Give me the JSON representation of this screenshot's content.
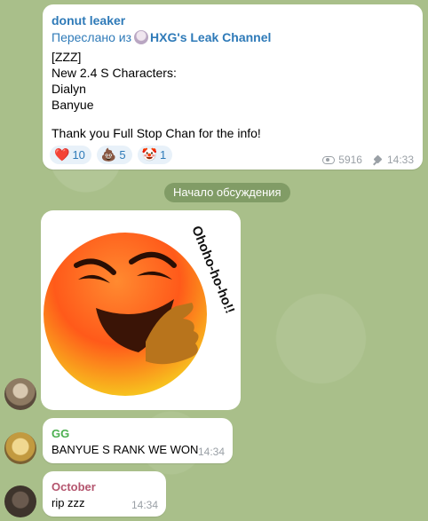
{
  "colors": {
    "accent": "#2e7ab8",
    "sender_top": "#2e7ab8",
    "sender_gg": "#4caf50",
    "sender_october": "#b4556e",
    "divider_bg": "#6f8a58",
    "reaction_bg": "#e8f1f9"
  },
  "top_message": {
    "sender": "donut leaker",
    "forwarded_prefix": "Переслано из",
    "channel": "HXG's Leak Channel",
    "lines": [
      "[ZZZ]",
      "New 2.4 S Characters:",
      "Dialyn",
      "Banyue",
      "",
      "Thank you Full Stop Chan for the info!"
    ],
    "reactions": [
      {
        "emoji": "❤️",
        "icon": "heart-icon",
        "count": "10"
      },
      {
        "emoji": "💩",
        "icon": "poop-icon",
        "count": "5"
      },
      {
        "emoji": "🤡",
        "icon": "clown-icon",
        "count": "1"
      }
    ],
    "views": "5916",
    "time": "14:33"
  },
  "divider": {
    "label": "Начало обсуждения"
  },
  "sticker": {
    "caption": "Ohoho-ho-ho!!"
  },
  "messages": [
    {
      "name": "GG",
      "text": "BANYUE S RANK WE WON",
      "time": "14:34"
    },
    {
      "name": "October",
      "text": "rip zzz",
      "time": "14:34"
    }
  ]
}
